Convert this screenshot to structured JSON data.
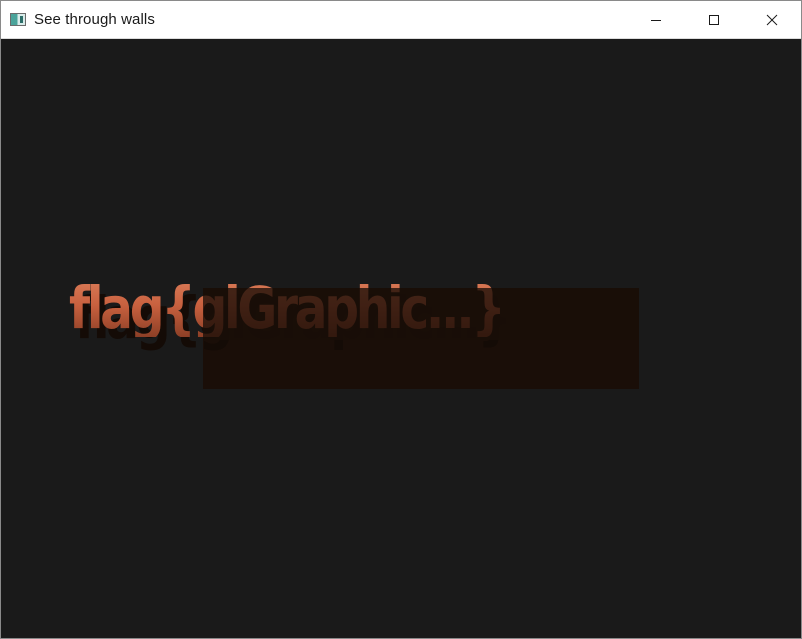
{
  "window": {
    "title": "See through walls",
    "controls": {
      "minimize_icon": "minimize-icon",
      "maximize_icon": "maximize-icon",
      "close_icon": "close-icon"
    }
  },
  "scene": {
    "flag_text": "flag{glGraphic...}",
    "colors": {
      "background": "#1a1a1a",
      "text": "#c8613f",
      "wall": "#1a0e08"
    }
  }
}
